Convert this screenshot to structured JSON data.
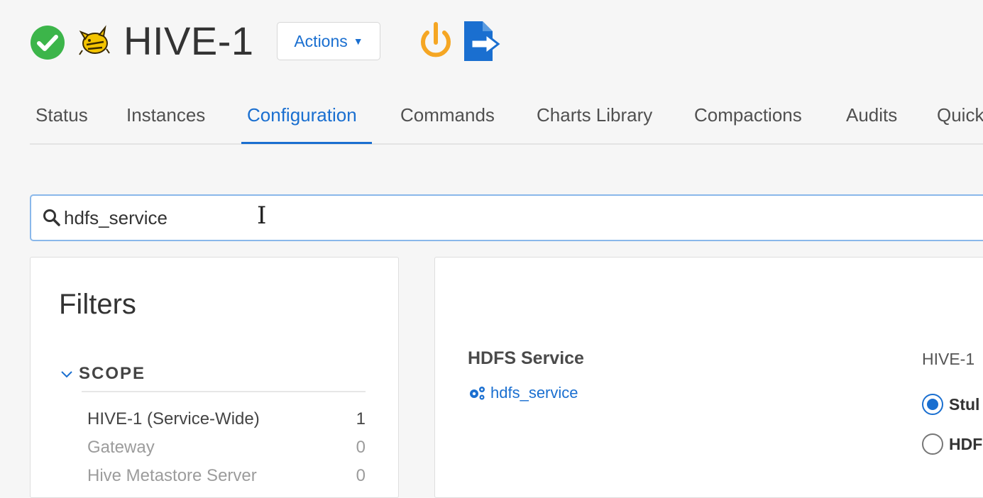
{
  "header": {
    "service_name": "HIVE-1",
    "actions_label": "Actions",
    "status": "good",
    "colors": {
      "status_green": "#3cb54a",
      "power_orange": "#f5a623",
      "export_blue": "#1a6fd0"
    }
  },
  "tabs": [
    {
      "label": "Status"
    },
    {
      "label": "Instances"
    },
    {
      "label": "Configuration",
      "active": true
    },
    {
      "label": "Commands"
    },
    {
      "label": "Charts Library"
    },
    {
      "label": "Compactions"
    },
    {
      "label": "Audits"
    },
    {
      "label": "Quick"
    }
  ],
  "search": {
    "value": "hdfs_service"
  },
  "filters": {
    "title": "Filters",
    "scope": {
      "label": "SCOPE",
      "items": [
        {
          "label": "HIVE-1 (Service-Wide)",
          "count": "1"
        },
        {
          "label": "Gateway",
          "count": "0"
        },
        {
          "label": "Hive Metastore Server",
          "count": "0"
        }
      ]
    }
  },
  "config": {
    "property_name": "HDFS Service",
    "property_key": "hdfs_service",
    "scope_value_label": "HIVE-1",
    "options": [
      {
        "label": "Stul",
        "checked": true
      },
      {
        "label": "HDF",
        "checked": false
      }
    ]
  }
}
